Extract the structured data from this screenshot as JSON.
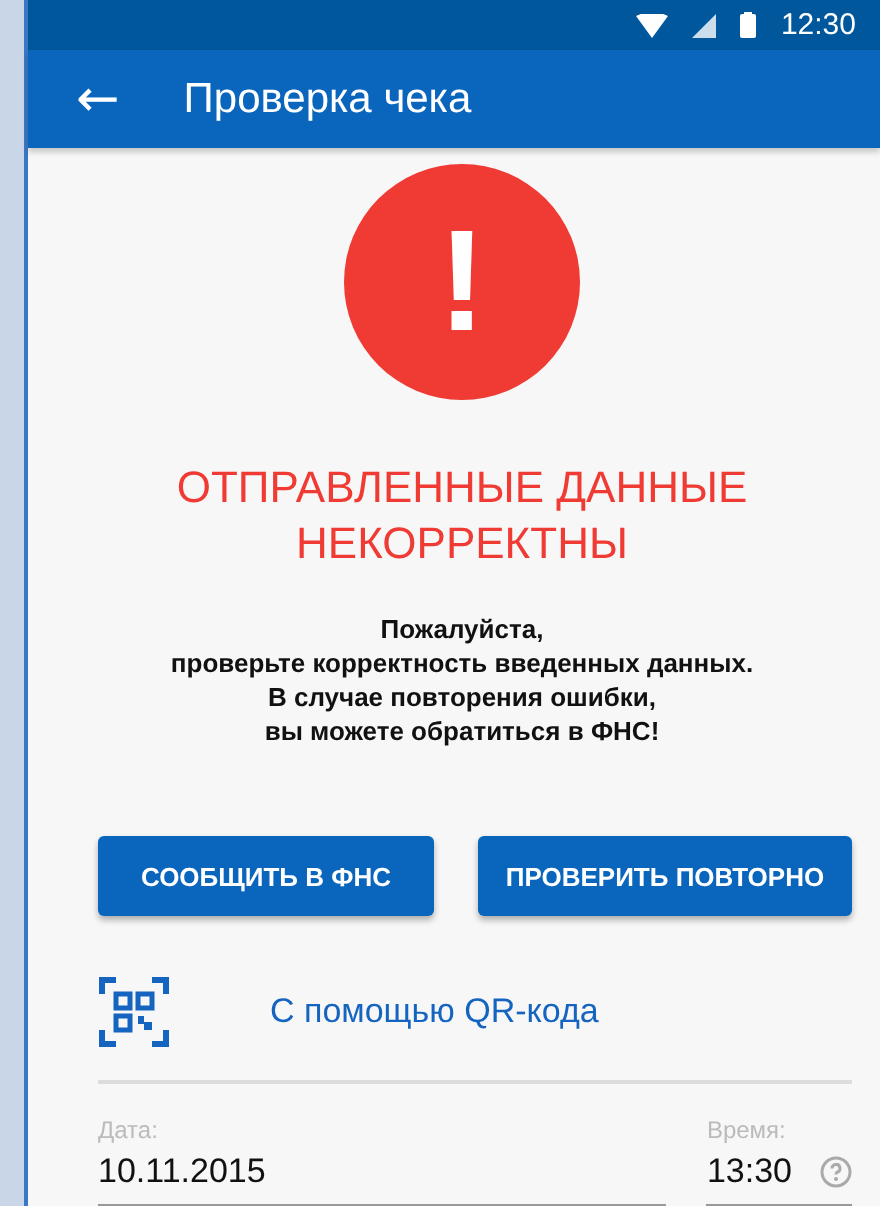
{
  "status_bar": {
    "time": "12:30"
  },
  "app_bar": {
    "back": "←",
    "title": "Проверка чека"
  },
  "error": {
    "icon": "!",
    "title": "ОТПРАВЛЕННЫЕ ДАННЫЕ НЕКОРРЕКТНЫ",
    "message": [
      "Пожалуйста,",
      "проверьте корректность введенных данных.",
      "В случае повторения ошибки,",
      "вы можете обратиться в ФНС!"
    ]
  },
  "buttons": [
    "СООБЩИТЬ В ФНС",
    "ПРОВЕРИТЬ ПОВТОРНО"
  ],
  "qr_link": "С помощью QR-кода",
  "fields": [
    {
      "label": "Дата:",
      "value": "10.11.2015",
      "help": false
    },
    {
      "label": "Время:",
      "value": "13:30",
      "help": true
    }
  ]
}
